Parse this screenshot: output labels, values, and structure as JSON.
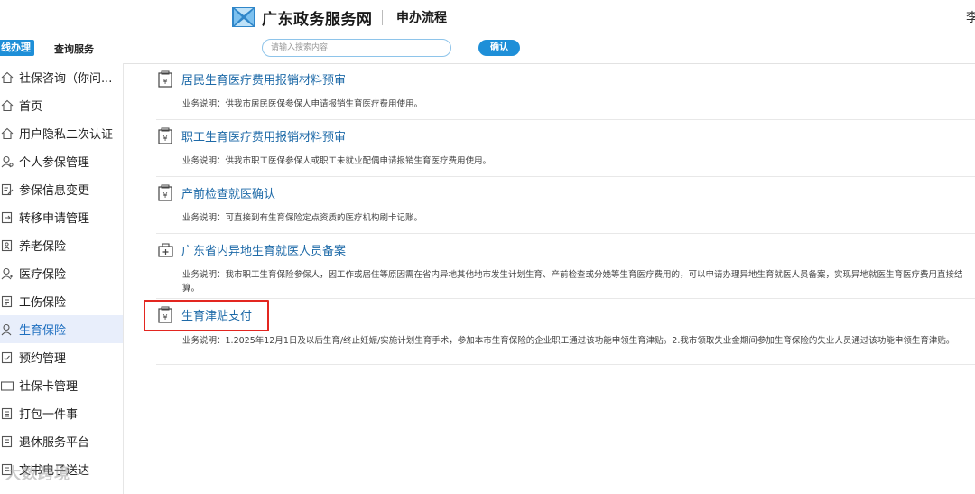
{
  "header": {
    "site_title": "广东政务服务网",
    "page_title": "申办流程",
    "user_initial": "李"
  },
  "subbar": {
    "tab_online": "线办理",
    "tab_query": "查询服务",
    "search_placeholder": "请输入搜索内容",
    "confirm_label": "确认"
  },
  "sidebar": {
    "items": [
      {
        "label": "社保咨询（你问...",
        "icon": "home-icon"
      },
      {
        "label": "首页",
        "icon": "home-icon"
      },
      {
        "label": "用户隐私二次认证",
        "icon": "home-icon"
      },
      {
        "label": "个人参保管理",
        "icon": "person-icon"
      },
      {
        "label": "参保信息变更",
        "icon": "edit-doc-icon"
      },
      {
        "label": "转移申请管理",
        "icon": "transfer-doc-icon"
      },
      {
        "label": "养老保险",
        "icon": "elder-icon"
      },
      {
        "label": "医疗保险",
        "icon": "medical-icon"
      },
      {
        "label": "工伤保险",
        "icon": "injury-icon"
      },
      {
        "label": "生育保险",
        "icon": "maternity-icon",
        "active": true
      },
      {
        "label": "预约管理",
        "icon": "calendar-icon"
      },
      {
        "label": "社保卡管理",
        "icon": "card-icon"
      },
      {
        "label": "打包一件事",
        "icon": "package-icon"
      },
      {
        "label": "退休服务平台",
        "icon": "retire-icon"
      },
      {
        "label": "文书电子送达",
        "icon": "document-icon"
      }
    ]
  },
  "services": [
    {
      "title": "居民生育医疗费用报销材料预审",
      "desc": "业务说明：供我市居民医保参保人申请报销生育医疗费用使用。"
    },
    {
      "title": "职工生育医疗费用报销材料预审",
      "desc": "业务说明：供我市职工医保参保人或职工未就业配偶申请报销生育医疗费用使用。"
    },
    {
      "title": "产前检查就医确认",
      "desc": "业务说明：可直接到有生育保险定点资质的医疗机构刷卡记账。"
    },
    {
      "title": "广东省内异地生育就医人员备案",
      "desc": "业务说明：我市职工生育保险参保人，因工作或居住等原因需在省内异地其他地市发生计划生育、产前检查或分娩等生育医疗费用的，可以申请办理异地生育就医人员备案，实现异地就医生育医疗费用直接结算。"
    },
    {
      "title": "生育津贴支付",
      "desc": "业务说明：1.2025年12月1日及以后生育/终止妊娠/实施计划生育手术，参加本市生育保险的企业职工通过该功能申领生育津贴。2.我市领取失业金期间参加生育保险的失业人员通过该功能申领生育津贴。"
    }
  ],
  "watermark": "大数跨境",
  "colors": {
    "accent": "#1e8fd8",
    "link": "#1e6aa8",
    "highlight": "#e32620",
    "active_bg": "#e8eefb"
  }
}
